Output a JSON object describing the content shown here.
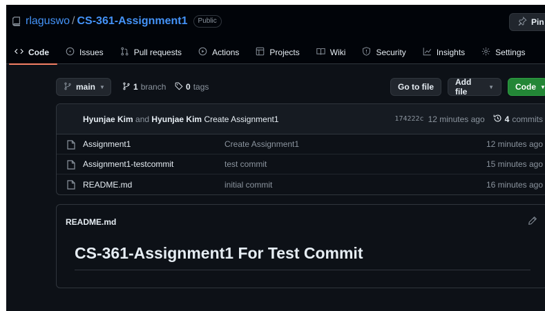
{
  "repo": {
    "owner": "rlaguswo",
    "separator": "/",
    "name": "CS-361-Assignment1",
    "visibility": "Public",
    "pin_label": "Pin"
  },
  "tabs": [
    {
      "label": "Code",
      "icon": "code-icon",
      "active": true
    },
    {
      "label": "Issues",
      "icon": "issue-icon"
    },
    {
      "label": "Pull requests",
      "icon": "pull-request-icon"
    },
    {
      "label": "Actions",
      "icon": "play-icon"
    },
    {
      "label": "Projects",
      "icon": "table-icon"
    },
    {
      "label": "Wiki",
      "icon": "book-icon"
    },
    {
      "label": "Security",
      "icon": "shield-icon"
    },
    {
      "label": "Insights",
      "icon": "graph-icon"
    },
    {
      "label": "Settings",
      "icon": "gear-icon"
    }
  ],
  "toolbar": {
    "branch": "main",
    "branch_count": "1",
    "branch_word": "branch",
    "tag_count": "0",
    "tag_word": "tags",
    "go_to_file": "Go to file",
    "add_file": "Add file",
    "code_button": "Code"
  },
  "commit": {
    "author1": "Hyunjae Kim",
    "and_word": "and",
    "author2": "Hyunjae Kim",
    "message": "Create Assignment1",
    "sha": "174222c",
    "time": "12 minutes ago",
    "commit_count": "4",
    "commit_word": "commits"
  },
  "files": [
    {
      "name": "Assignment1",
      "message": "Create Assignment1",
      "time": "12 minutes ago"
    },
    {
      "name": "Assignment1-testcommit",
      "message": "test commit",
      "time": "15 minutes ago"
    },
    {
      "name": "README.md",
      "message": "initial commit",
      "time": "16 minutes ago"
    }
  ],
  "readme": {
    "filename": "README.md",
    "heading": "CS-361-Assignment1 For Test Commit"
  },
  "colors": {
    "background": "#0d1117",
    "header": "#010409",
    "link": "#4493f8",
    "green": "#238636",
    "active_tab_underline": "#f78166"
  }
}
